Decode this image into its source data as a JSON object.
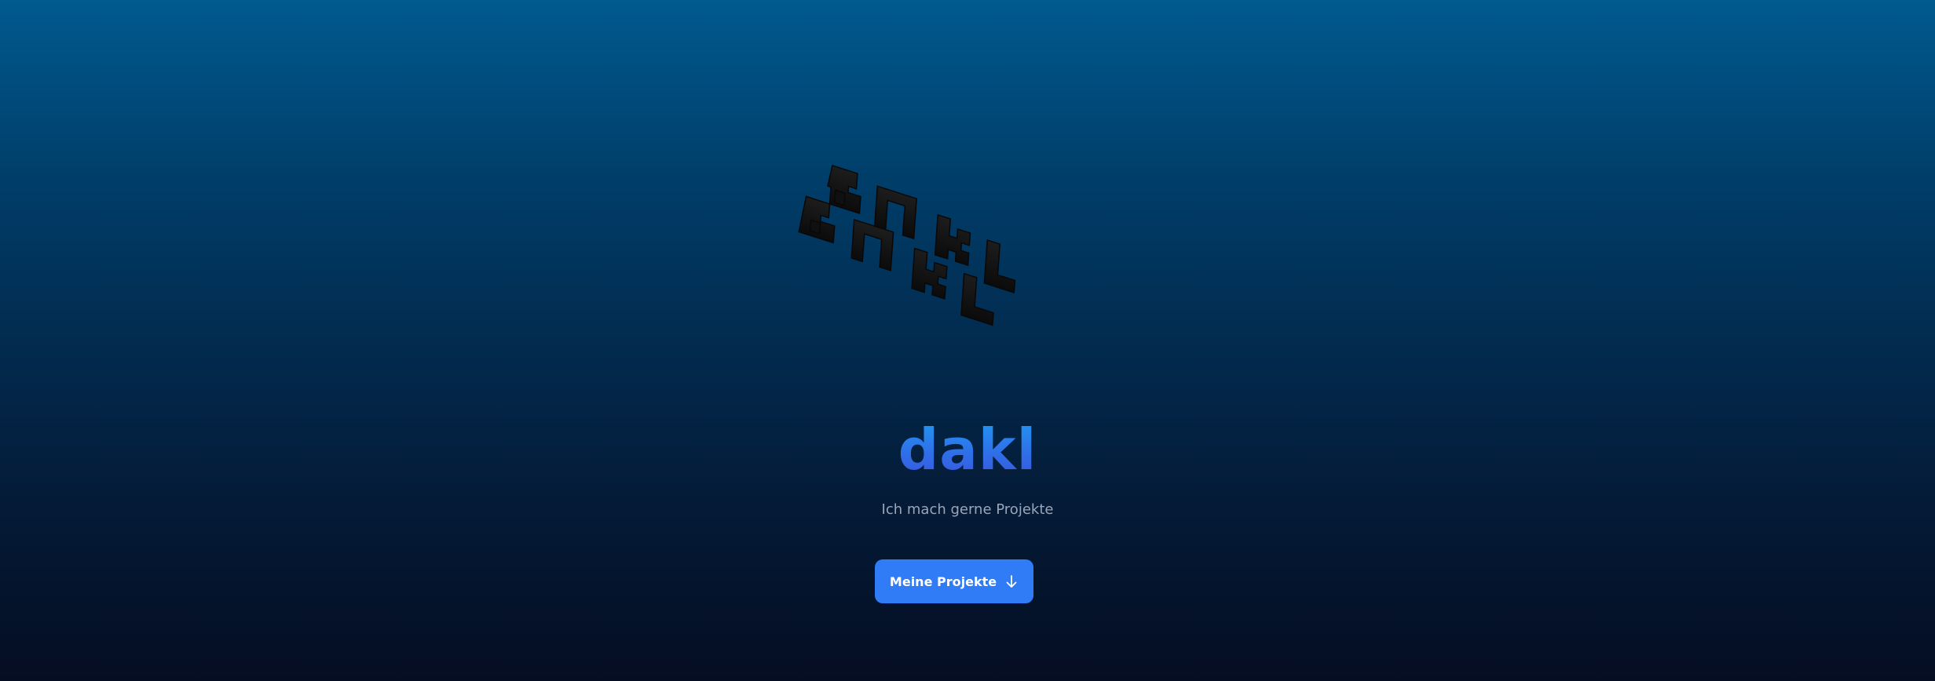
{
  "hero": {
    "title": "dakl",
    "tagline": "Ich mach gerne Projekte",
    "cta_label": "Meine Projekte",
    "cta_icon": "arrow-down-icon",
    "logo_icon": "dakl-3d-block-logo"
  },
  "colors": {
    "background_top": "#005a8f",
    "background_bottom": "#050d22",
    "title_gradient_top": "#1ea0f5",
    "title_gradient_bottom": "#3b4fdc",
    "tagline": "#9aa6b8",
    "button": "#2f7cf6",
    "button_text": "#ffffff",
    "logo_block": "#151515"
  }
}
